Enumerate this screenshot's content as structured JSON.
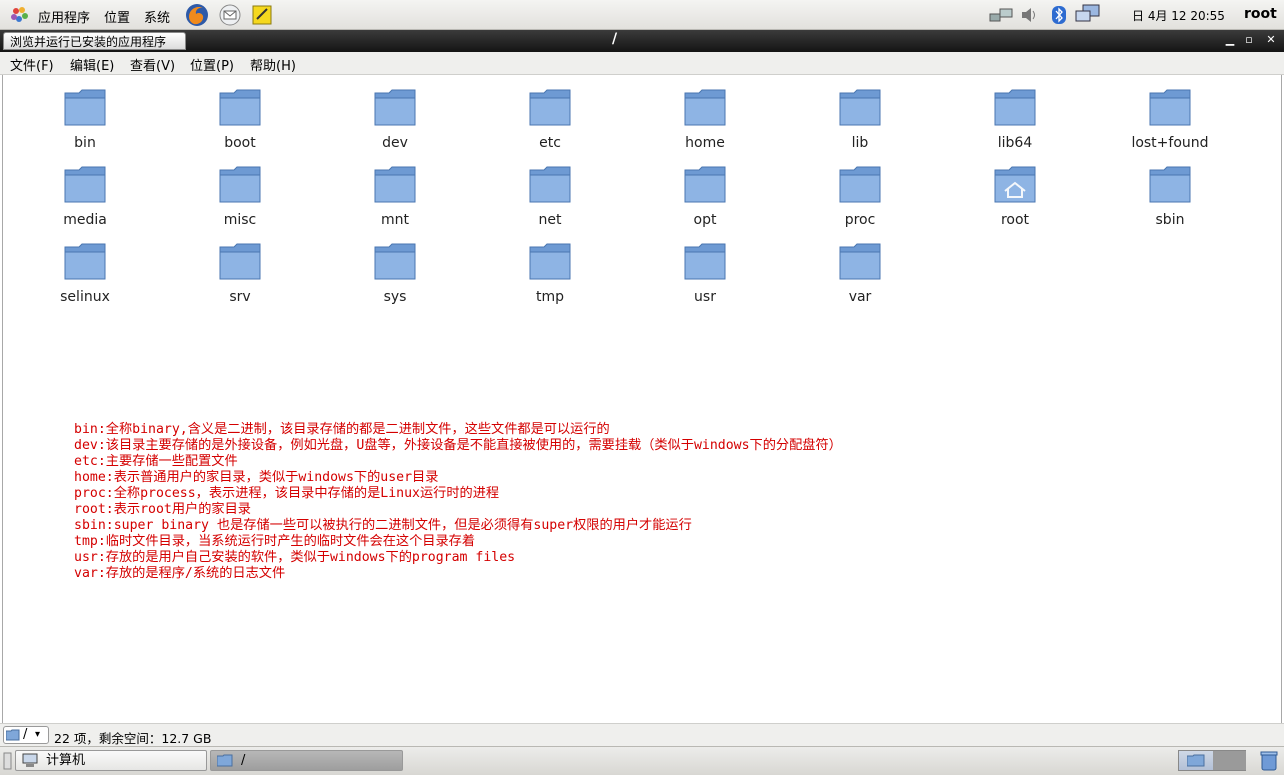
{
  "top_panel": {
    "menus": [
      "应用程序",
      "位置",
      "系统"
    ],
    "launchers": [
      "firefox-icon",
      "mail-icon",
      "notes-icon"
    ],
    "tray": [
      "network-icon",
      "volume-icon",
      "bluetooth-icon",
      "display-icon"
    ],
    "clock": "日 4月 12 20:55",
    "user": "root"
  },
  "window": {
    "tab_label": "浏览并运行已安装的应用程序",
    "title": "/",
    "buttons": [
      "minimize",
      "maximize",
      "close"
    ]
  },
  "menubar": [
    "文件(F)",
    "编辑(E)",
    "查看(V)",
    "位置(P)",
    "帮助(H)"
  ],
  "folders": [
    {
      "name": "bin",
      "icon": "folder-icon"
    },
    {
      "name": "boot",
      "icon": "folder-icon"
    },
    {
      "name": "dev",
      "icon": "folder-icon"
    },
    {
      "name": "etc",
      "icon": "folder-icon"
    },
    {
      "name": "home",
      "icon": "folder-icon"
    },
    {
      "name": "lib",
      "icon": "folder-icon"
    },
    {
      "name": "lib64",
      "icon": "folder-icon"
    },
    {
      "name": "lost+found",
      "icon": "folder-icon"
    },
    {
      "name": "media",
      "icon": "folder-icon"
    },
    {
      "name": "misc",
      "icon": "folder-icon"
    },
    {
      "name": "mnt",
      "icon": "folder-icon"
    },
    {
      "name": "net",
      "icon": "folder-icon"
    },
    {
      "name": "opt",
      "icon": "folder-icon"
    },
    {
      "name": "proc",
      "icon": "folder-icon"
    },
    {
      "name": "root",
      "icon": "home-folder-icon"
    },
    {
      "name": "sbin",
      "icon": "folder-icon"
    },
    {
      "name": "selinux",
      "icon": "folder-icon"
    },
    {
      "name": "srv",
      "icon": "folder-icon"
    },
    {
      "name": "sys",
      "icon": "folder-icon"
    },
    {
      "name": "tmp",
      "icon": "folder-icon"
    },
    {
      "name": "usr",
      "icon": "folder-icon"
    },
    {
      "name": "var",
      "icon": "folder-icon"
    }
  ],
  "notes": [
    "bin:全称binary,含义是二进制，该目录存储的都是二进制文件，这些文件都是可以运行的",
    "dev:该目录主要存储的是外接设备，例如光盘，U盘等，外接设备是不能直接被使用的，需要挂载（类似于windows下的分配盘符）",
    "etc:主要存储一些配置文件",
    "home:表示普通用户的家目录，类似于windows下的user目录",
    "proc:全称process，表示进程，该目录中存储的是Linux运行时的进程",
    "root:表示root用户的家目录",
    "sbin:super binary 也是存储一些可以被执行的二进制文件，但是必须得有super权限的用户才能运行",
    "tmp:临时文件目录，当系统运行时产生的临时文件会在这个目录存着",
    "usr:存放的是用户自己安装的软件，类似于windows下的program files",
    "var:存放的是程序/系统的日志文件"
  ],
  "statusbar": {
    "path": "/",
    "text": "22 项，剩余空间：12.7 GB"
  },
  "taskbar": {
    "items": [
      {
        "label": "计算机",
        "icon": "computer-icon"
      },
      {
        "label": "/",
        "icon": "folder-icon"
      }
    ]
  },
  "colors": {
    "folder_blue": "#7fa7d9",
    "notes_red": "#d40000",
    "titlebar": "#222222"
  }
}
